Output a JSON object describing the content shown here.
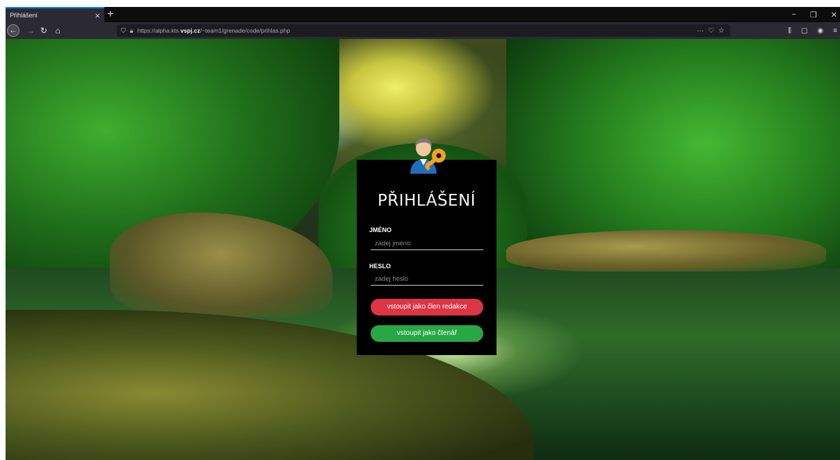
{
  "browser": {
    "tab_title": "Přihlášení",
    "tab_close": "×",
    "new_tab": "+",
    "url_prefix": "https://alpha.kts.",
    "url_domain": "vspj.cz",
    "url_path": "/~team1/grenade/code/prihlas.php",
    "page_actions": "···",
    "win_minimize": "−",
    "win_maximize": "❐",
    "win_close": "✕"
  },
  "login": {
    "title": "PŘIHLÁŠENÍ",
    "username_label": "JMÉNO",
    "username_placeholder": "zadej jméno",
    "password_label": "HESLO",
    "password_placeholder": "zadej heslo",
    "editor_button": "vstoupit jako člen redakce",
    "reader_button": "vstoupit jako čtenář"
  },
  "colors": {
    "editor_button": "#dc3545",
    "reader_button": "#28a745",
    "card_bg": "#000000"
  }
}
